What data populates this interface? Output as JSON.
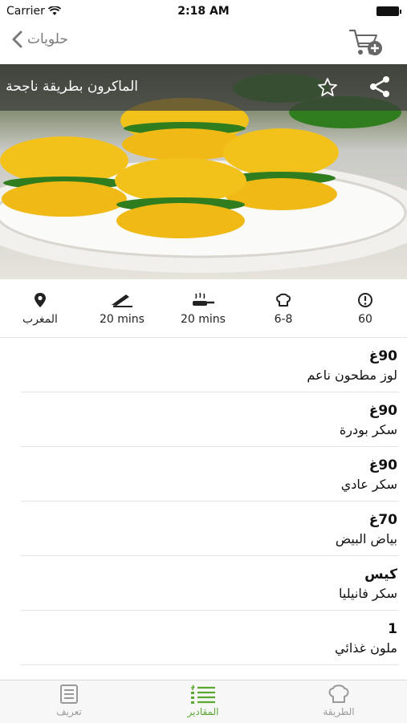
{
  "status_bar": {
    "carrier": "Carrier",
    "time": "2:18 AM"
  },
  "nav": {
    "back_label": "حلويات"
  },
  "recipe": {
    "title": "الماكرون بطريقة ناجحة"
  },
  "stats": [
    {
      "icon": "location-pin-icon",
      "value": "المغرب"
    },
    {
      "icon": "knife-icon",
      "value": "20 mins"
    },
    {
      "icon": "pan-icon",
      "value": "20 mins"
    },
    {
      "icon": "chef-hat-icon",
      "value": "6-8"
    },
    {
      "icon": "info-icon",
      "value": "60"
    }
  ],
  "ingredients": [
    {
      "qty": "90غ",
      "name": "لوز مطحون ناعم"
    },
    {
      "qty": "90غ",
      "name": "سكر بودرة"
    },
    {
      "qty": "90غ",
      "name": "سكر عادي"
    },
    {
      "qty": "70غ",
      "name": "بياض البيض"
    },
    {
      "qty": "كيس",
      "name": "سكر فانيليا"
    },
    {
      "qty": "1",
      "name": "ملون غذائي"
    }
  ],
  "tabs": [
    {
      "label": "تعريف",
      "icon": "document-icon"
    },
    {
      "label": "المقادير",
      "icon": "list-icon",
      "active": true
    },
    {
      "label": "الطريقة",
      "icon": "chef-hat-icon"
    }
  ],
  "colors": {
    "accent": "#5aa831",
    "overlay": "#3c3c3c",
    "macaron": "#f2c21b",
    "filling": "#2f7d1f"
  }
}
